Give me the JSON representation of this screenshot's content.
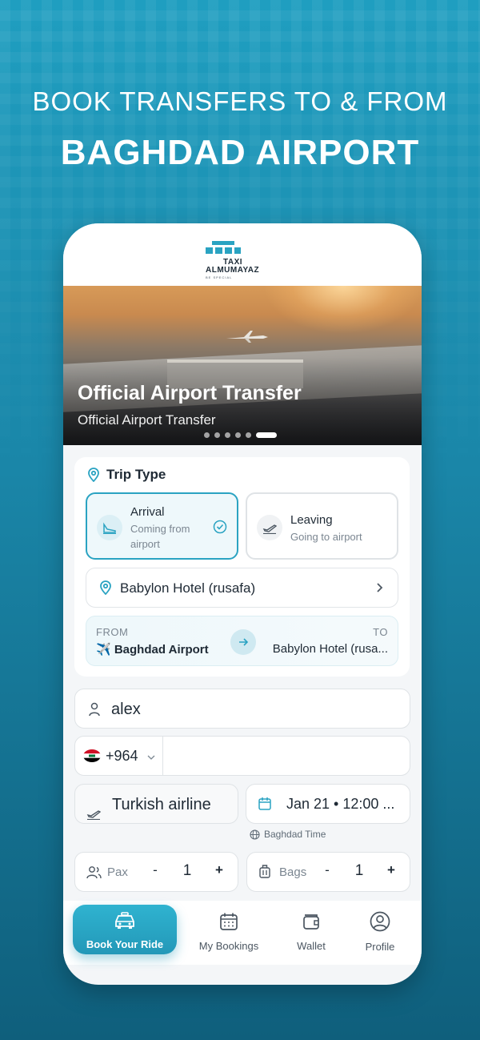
{
  "promo": {
    "line1": "BOOK TRANSFERS TO & FROM",
    "line2": "BAGHDAD AIRPORT"
  },
  "app": {
    "logo": {
      "line1": "TAXI",
      "line2": "ALMUMAYAZ",
      "tagline": "BE SPECIAL"
    },
    "hero": {
      "title": "Official Airport Transfer",
      "subtitle": "Official Airport Transfer",
      "slides_total": 6,
      "active_slide": 6
    },
    "trip_type": {
      "heading": "Trip Type",
      "options": [
        {
          "title": "Arrival",
          "subtitle": "Coming from airport",
          "selected": true
        },
        {
          "title": "Leaving",
          "subtitle": "Going to airport",
          "selected": false
        }
      ]
    },
    "destination": "Babylon Hotel (rusafa)",
    "route": {
      "from_label": "FROM",
      "from_value": "✈️ Baghdad Airport",
      "to_label": "TO",
      "to_value": "Babylon Hotel (rusa..."
    },
    "form": {
      "name": "alex",
      "country_code": "+964",
      "phone": "",
      "airline": "Turkish airline",
      "datetime": "Jan 21 • 12:00 ...",
      "time_note": "Baghdad Time",
      "pax": {
        "label": "Pax",
        "minus": "-",
        "value": "1",
        "plus": "+"
      },
      "bags": {
        "label": "Bags",
        "minus": "-",
        "value": "1",
        "plus": "+"
      }
    },
    "nav": [
      {
        "label": "Book Your Ride",
        "icon": "taxi-icon",
        "active": true
      },
      {
        "label": "My Bookings",
        "icon": "calendar-icon",
        "active": false
      },
      {
        "label": "Wallet",
        "icon": "wallet-icon",
        "active": false
      },
      {
        "label": "Profile",
        "icon": "profile-icon",
        "active": false
      }
    ],
    "colors": {
      "accent": "#2aa3c2",
      "background": "#1a86a8"
    }
  }
}
